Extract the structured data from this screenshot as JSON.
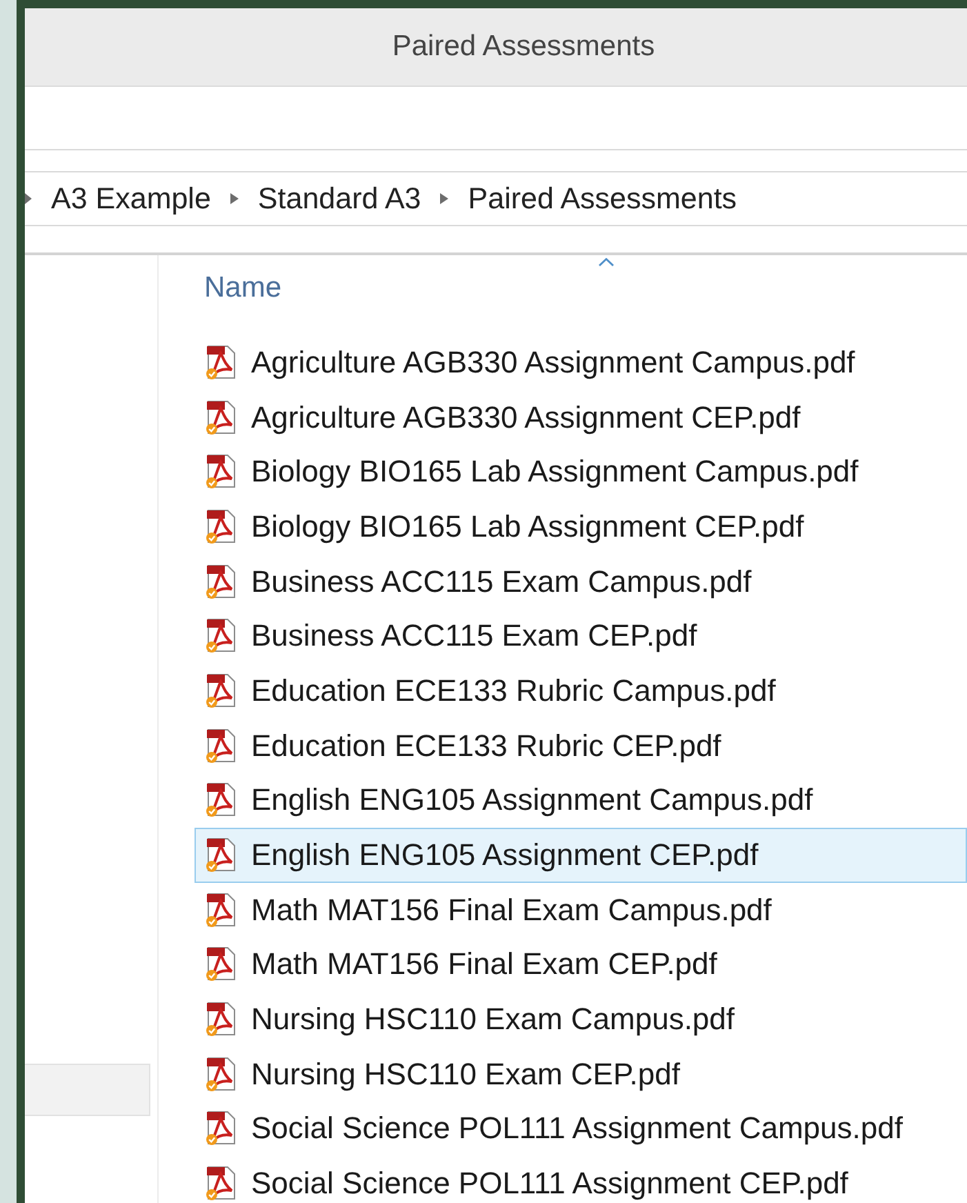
{
  "window": {
    "title": "Paired Assessments"
  },
  "breadcrumb": [
    {
      "label": "A3 Example"
    },
    {
      "label": "Standard A3"
    },
    {
      "label": "Paired Assessments"
    }
  ],
  "columns": [
    {
      "label": "Name",
      "sorted": true
    }
  ],
  "files": [
    {
      "name": "Agriculture AGB330 Assignment Campus.pdf",
      "selected": false
    },
    {
      "name": "Agriculture AGB330 Assignment CEP.pdf",
      "selected": false
    },
    {
      "name": "Biology BIO165 Lab Assignment Campus.pdf",
      "selected": false
    },
    {
      "name": "Biology BIO165 Lab Assignment CEP.pdf",
      "selected": false
    },
    {
      "name": "Business ACC115 Exam Campus.pdf",
      "selected": false
    },
    {
      "name": "Business ACC115 Exam CEP.pdf",
      "selected": false
    },
    {
      "name": "Education ECE133 Rubric Campus.pdf",
      "selected": false
    },
    {
      "name": "Education ECE133 Rubric CEP.pdf",
      "selected": false
    },
    {
      "name": "English ENG105 Assignment Campus.pdf",
      "selected": false
    },
    {
      "name": "English ENG105 Assignment CEP.pdf",
      "selected": true
    },
    {
      "name": "Math MAT156 Final Exam Campus.pdf",
      "selected": false
    },
    {
      "name": "Math MAT156 Final Exam CEP.pdf",
      "selected": false
    },
    {
      "name": "Nursing HSC110 Exam Campus.pdf",
      "selected": false
    },
    {
      "name": "Nursing HSC110 Exam CEP.pdf",
      "selected": false
    },
    {
      "name": "Social Science POL111 Assignment Campus.pdf",
      "selected": false
    },
    {
      "name": "Social Science POL111 Assignment CEP.pdf",
      "selected": false
    }
  ]
}
